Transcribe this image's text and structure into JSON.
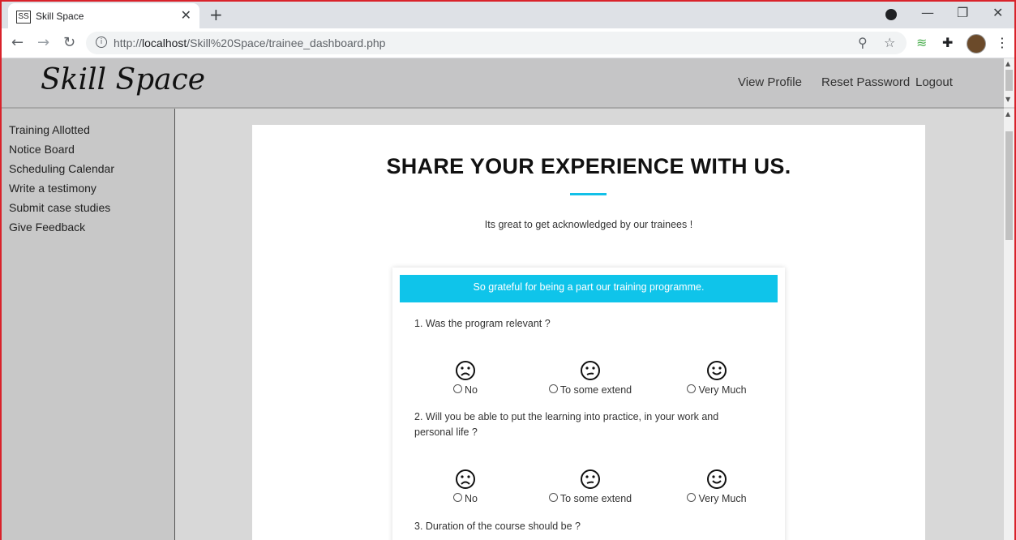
{
  "browser": {
    "tab_title": "Skill Space",
    "favicon_text": "SS",
    "url_prefix": "http://",
    "url_host": "localhost",
    "url_path": "/Skill%20Space/trainee_dashboard.php"
  },
  "site": {
    "logo": "Skill Space",
    "nav": [
      "View Profile",
      "Reset Password",
      "Logout"
    ]
  },
  "sidebar": {
    "items": [
      "Training Allotted",
      "Notice Board",
      "Scheduling Calendar",
      "Write a testimony",
      "Submit case studies",
      "Give Feedback"
    ]
  },
  "main": {
    "heading": "SHARE YOUR EXPERIENCE WITH US.",
    "subheading": "Its great to get acknowledged by our trainees !",
    "banner": "So grateful for being a part our training programme.",
    "questions": [
      "1. Was the program relevant ?",
      "2.  Will you be able to put the learning into practice, in your work and personal life ?",
      "3. Duration of the course should be ?"
    ],
    "options": [
      "No",
      "To some extend",
      "Very Much"
    ]
  },
  "colors": {
    "accent": "#0fc4ea",
    "header_bg": "#c5c5c6",
    "sidebar_bg": "#c8c8c8",
    "frame_border": "#d9222a"
  }
}
